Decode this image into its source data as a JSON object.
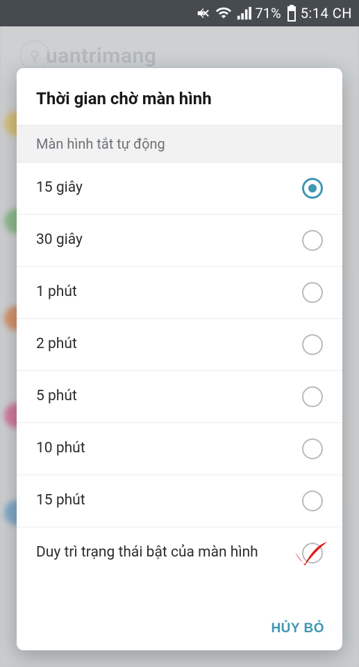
{
  "status": {
    "battery_pct": "71%",
    "time": "5:14 CH"
  },
  "watermark": {
    "text": "uantrimang"
  },
  "dialog": {
    "title": "Thời gian chờ màn hình",
    "section_header": "Màn hình tắt tự động",
    "options": [
      {
        "label": "15 giây",
        "selected": true
      },
      {
        "label": "30 giây",
        "selected": false
      },
      {
        "label": "1 phút",
        "selected": false
      },
      {
        "label": "2 phút",
        "selected": false
      },
      {
        "label": "5 phút",
        "selected": false
      },
      {
        "label": "10 phút",
        "selected": false
      },
      {
        "label": "15 phút",
        "selected": false
      },
      {
        "label": "Duy trì trạng thái bật của màn hình",
        "selected": false,
        "annotated": true
      }
    ],
    "cancel_label": "HỦY BỎ"
  }
}
